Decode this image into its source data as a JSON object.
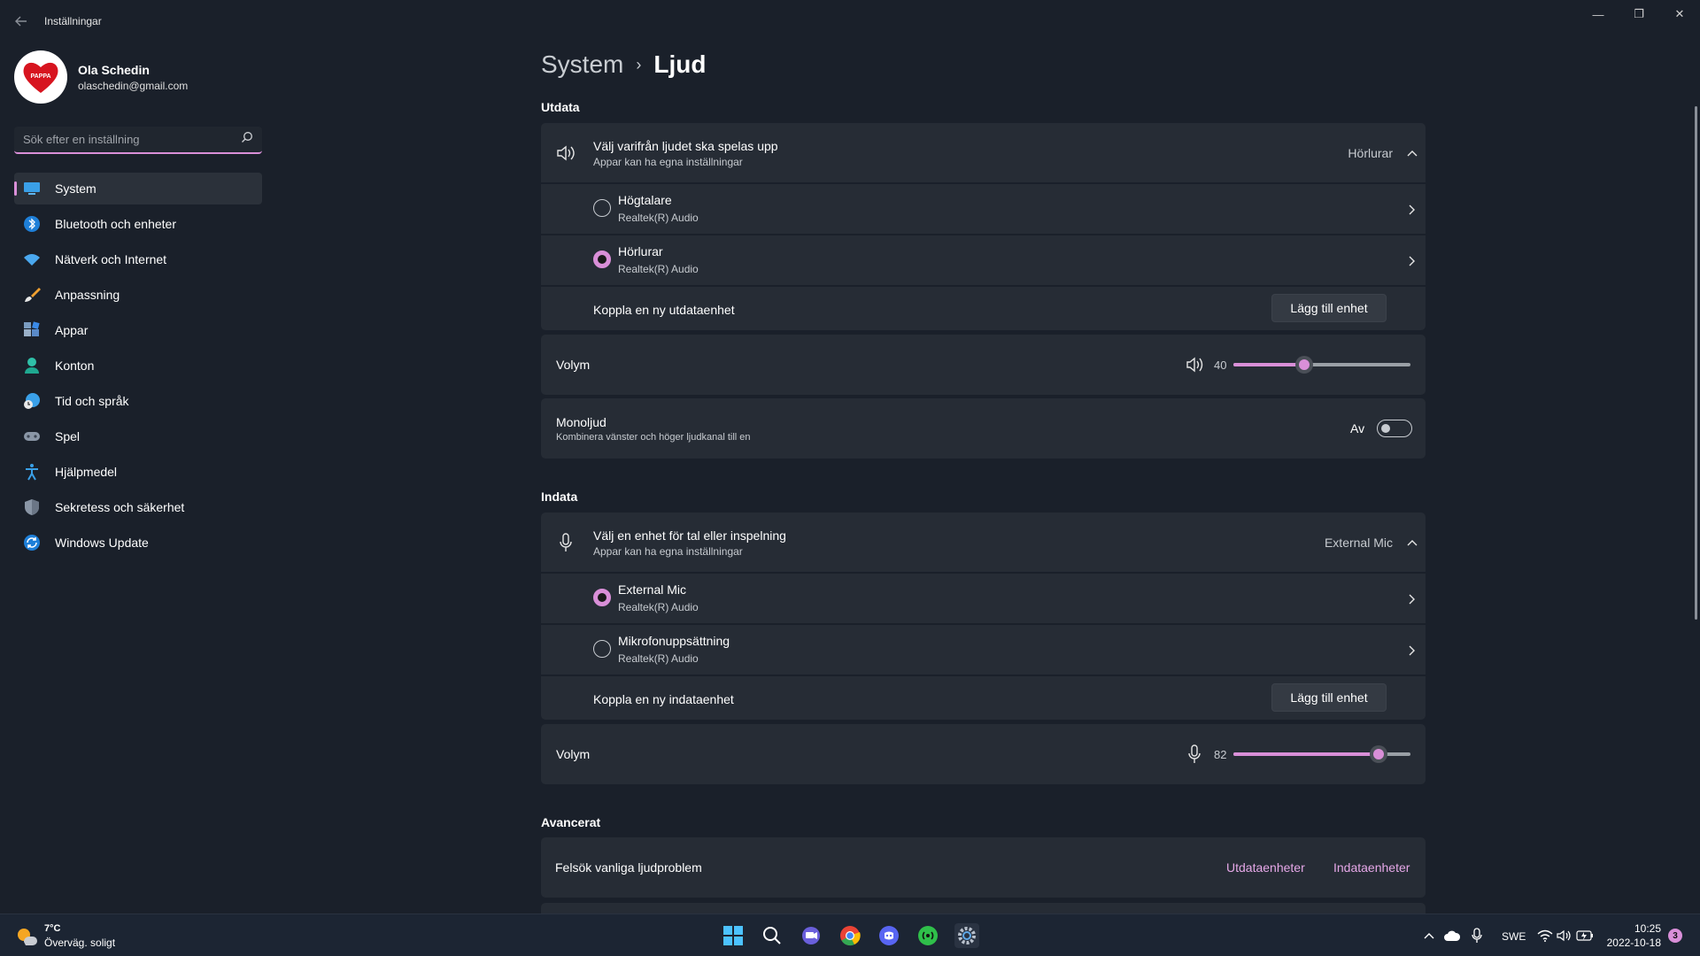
{
  "window": {
    "title": "Inställningar",
    "minimize": "—",
    "maximize": "❐",
    "close": "✕"
  },
  "profile": {
    "name": "Ola Schedin",
    "email": "olaschedin@gmail.com",
    "avatar_text": "PAPPA"
  },
  "search": {
    "placeholder": "Sök efter en inställning"
  },
  "sidebar": {
    "items": [
      {
        "label": "System",
        "icon": "display-icon"
      },
      {
        "label": "Bluetooth och enheter",
        "icon": "bluetooth-icon"
      },
      {
        "label": "Nätverk och Internet",
        "icon": "wifi-icon"
      },
      {
        "label": "Anpassning",
        "icon": "brush-icon"
      },
      {
        "label": "Appar",
        "icon": "apps-icon"
      },
      {
        "label": "Konton",
        "icon": "person-icon"
      },
      {
        "label": "Tid och språk",
        "icon": "clock-globe-icon"
      },
      {
        "label": "Spel",
        "icon": "gamepad-icon"
      },
      {
        "label": "Hjälpmedel",
        "icon": "accessibility-icon"
      },
      {
        "label": "Sekretess och säkerhet",
        "icon": "shield-icon"
      },
      {
        "label": "Windows Update",
        "icon": "update-icon"
      }
    ]
  },
  "breadcrumb": {
    "parent": "System",
    "separator": "›",
    "current": "Ljud"
  },
  "output": {
    "section_title": "Utdata",
    "chooser_title": "Välj varifrån ljudet ska spelas upp",
    "chooser_sub": "Appar kan ha egna inställningar",
    "chooser_value": "Hörlurar",
    "devices": [
      {
        "name": "Högtalare",
        "driver": "Realtek(R) Audio",
        "selected": false
      },
      {
        "name": "Hörlurar",
        "driver": "Realtek(R) Audio",
        "selected": true
      }
    ],
    "connect_label": "Koppla en ny utdataenhet",
    "add_button": "Lägg till enhet",
    "volume_label": "Volym",
    "volume_value": "40",
    "volume_percent": 40,
    "mono_title": "Monoljud",
    "mono_sub": "Kombinera vänster och höger ljudkanal till en",
    "mono_state": "Av"
  },
  "input": {
    "section_title": "Indata",
    "chooser_title": "Välj en enhet för tal eller inspelning",
    "chooser_sub": "Appar kan ha egna inställningar",
    "chooser_value": "External Mic",
    "devices": [
      {
        "name": "External Mic",
        "driver": "Realtek(R) Audio",
        "selected": true
      },
      {
        "name": "Mikrofonuppsättning",
        "driver": "Realtek(R) Audio",
        "selected": false
      }
    ],
    "connect_label": "Koppla en ny indataenhet",
    "add_button": "Lägg till enhet",
    "volume_label": "Volym",
    "volume_value": "82",
    "volume_percent": 82
  },
  "advanced": {
    "section_title": "Avancerat",
    "troubleshoot_label": "Felsök vanliga ljudproblem",
    "link_output": "Utdataenheter",
    "link_input": "Indataenheter"
  },
  "taskbar": {
    "weather_temp": "7°C",
    "weather_desc": "Överväg. soligt",
    "language": "SWE",
    "time": "10:25",
    "date": "2022-10-18",
    "notification_count": "3"
  },
  "colors": {
    "accent": "#d98fd8",
    "background": "#1a202a",
    "card": "#262c35"
  }
}
